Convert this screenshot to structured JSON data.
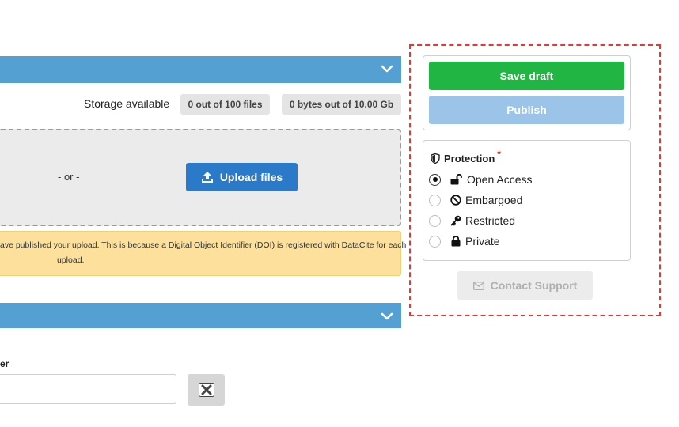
{
  "storage": {
    "label": "Storage available",
    "files_pill": "0 out of 100 files",
    "bytes_pill": "0 bytes out of 10.00 Gb"
  },
  "dropzone": {
    "or_text": "- or -",
    "upload_label": "Upload files"
  },
  "notice": {
    "line1": "ave published your upload. This is because a Digital Object Identifier (DOI) is registered with DataCite for each",
    "line2": "upload."
  },
  "identifier_field": {
    "label": "er",
    "value": ""
  },
  "actions": {
    "save_label": "Save draft",
    "publish_label": "Publish",
    "contact_label": "Contact Support"
  },
  "protection": {
    "title": "Protection",
    "required_mark": "*",
    "options": [
      {
        "label": "Open Access",
        "icon": "unlock-icon",
        "checked": true
      },
      {
        "label": "Embargoed",
        "icon": "ban-icon",
        "checked": false
      },
      {
        "label": "Restricted",
        "icon": "key-icon",
        "checked": false
      },
      {
        "label": "Private",
        "icon": "lock-icon",
        "checked": false
      }
    ]
  },
  "colors": {
    "section_bar": "#54a0d3",
    "save": "#21b544",
    "publish_disabled": "#9cc4e8",
    "upload": "#2b7ac9",
    "notice_bg": "#fde09b",
    "highlight": "#e53935"
  }
}
